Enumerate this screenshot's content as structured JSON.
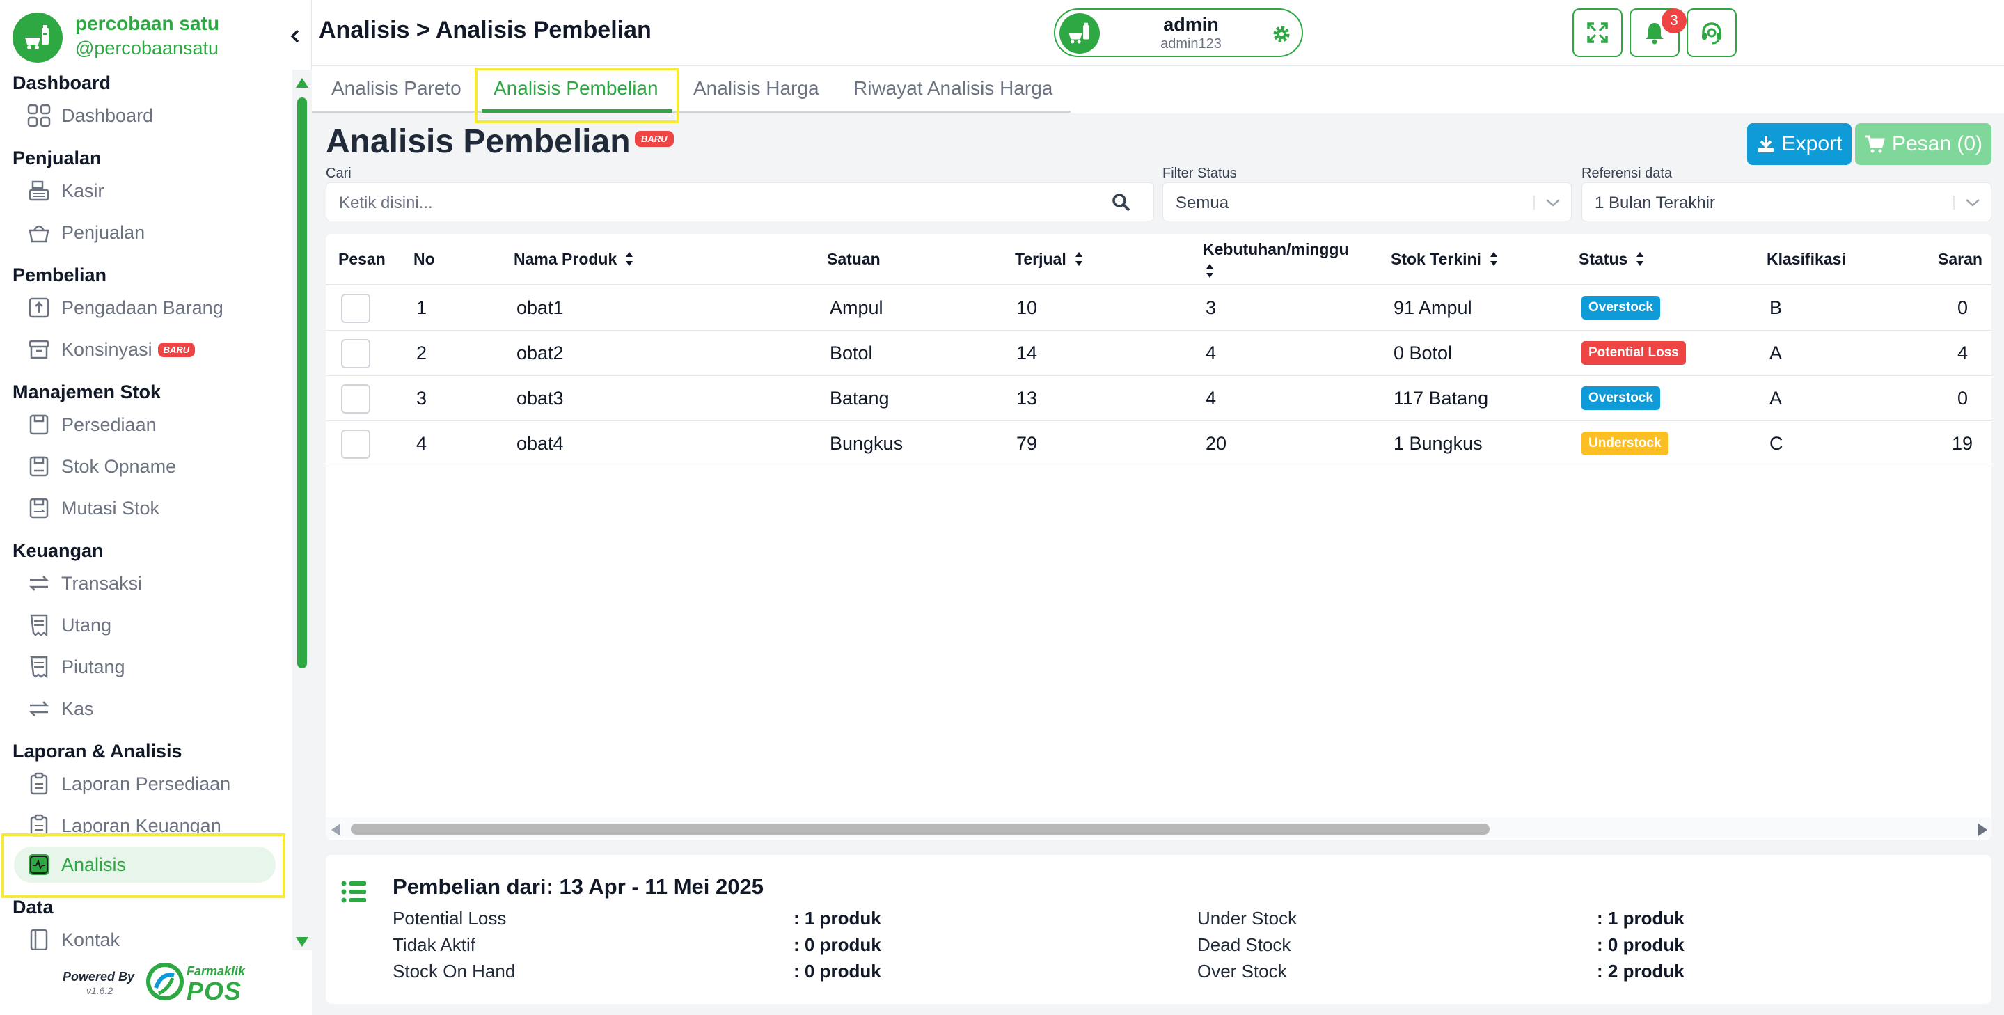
{
  "brand": {
    "store_name": "percobaan satu",
    "store_handle": "@percobaansatu"
  },
  "sidebar": {
    "sections": [
      {
        "title": "Dashboard",
        "items": [
          {
            "label": "Dashboard",
            "icon": "grid-icon"
          }
        ]
      },
      {
        "title": "Penjualan",
        "items": [
          {
            "label": "Kasir",
            "icon": "cash-register-icon"
          },
          {
            "label": "Penjualan",
            "icon": "basket-icon"
          }
        ]
      },
      {
        "title": "Pembelian",
        "items": [
          {
            "label": "Pengadaan Barang",
            "icon": "procurement-icon"
          },
          {
            "label": "Konsinyasi",
            "icon": "archive-box-icon",
            "badge": "BARU"
          }
        ]
      },
      {
        "title": "Manajemen Stok",
        "items": [
          {
            "label": "Persediaan",
            "icon": "inventory-icon"
          },
          {
            "label": "Stok Opname",
            "icon": "stock-opname-icon"
          },
          {
            "label": "Mutasi Stok",
            "icon": "stock-mutation-icon"
          }
        ]
      },
      {
        "title": "Keuangan",
        "items": [
          {
            "label": "Transaksi",
            "icon": "exchange-icon"
          },
          {
            "label": "Utang",
            "icon": "receipt-icon"
          },
          {
            "label": "Piutang",
            "icon": "receipt-icon"
          },
          {
            "label": "Kas",
            "icon": "exchange-icon"
          }
        ]
      },
      {
        "title": "Laporan & Analisis",
        "items": [
          {
            "label": "Laporan Persediaan",
            "icon": "clipboard-icon"
          },
          {
            "label": "Laporan Keuangan",
            "icon": "clipboard-icon"
          },
          {
            "label": "Analisis",
            "icon": "analytics-icon",
            "active": true
          }
        ]
      },
      {
        "title": "Data",
        "items": [
          {
            "label": "Kontak",
            "icon": "contact-book-icon"
          }
        ]
      }
    ],
    "powered_by": "Powered By",
    "version": "v1.6.2",
    "brand_small": "Farmaklik",
    "brand_big": "POS"
  },
  "topbar": {
    "breadcrumb": "Analisis > Analisis Pembelian",
    "notification_count": "3",
    "user_name": "admin",
    "user_role": "admin123"
  },
  "tabs": [
    {
      "label": "Analisis Pareto",
      "active": false
    },
    {
      "label": "Analisis Pembelian",
      "active": true
    },
    {
      "label": "Analisis Harga",
      "active": false
    },
    {
      "label": "Riwayat Analisis Harga",
      "active": false
    }
  ],
  "page": {
    "title": "Analisis Pembelian",
    "title_badge": "BARU",
    "export_label": "Export",
    "pesan_label": "Pesan (0)"
  },
  "filters": {
    "search_label": "Cari",
    "search_placeholder": "Ketik disini...",
    "status_label": "Filter Status",
    "status_value": "Semua",
    "reference_label": "Referensi data",
    "reference_value": "1 Bulan Terakhir"
  },
  "table": {
    "columns": [
      "Pesan",
      "No",
      "Nama Produk",
      "Satuan",
      "Terjual",
      "Kebutuhan/minggu",
      "Stok Terkini",
      "Status",
      "Klasifikasi",
      "Saran"
    ],
    "rows": [
      {
        "no": "1",
        "nama": "obat1",
        "satuan": "Ampul",
        "terjual": "10",
        "kebutuhan": "3",
        "stok": "91 Ampul",
        "status": "Overstock",
        "klasifikasi": "B",
        "saran": "0"
      },
      {
        "no": "2",
        "nama": "obat2",
        "satuan": "Botol",
        "terjual": "14",
        "kebutuhan": "4",
        "stok": "0 Botol",
        "status": "Potential Loss",
        "klasifikasi": "A",
        "saran": "4"
      },
      {
        "no": "3",
        "nama": "obat3",
        "satuan": "Batang",
        "terjual": "13",
        "kebutuhan": "4",
        "stok": "117 Batang",
        "status": "Overstock",
        "klasifikasi": "A",
        "saran": "0"
      },
      {
        "no": "4",
        "nama": "obat4",
        "satuan": "Bungkus",
        "terjual": "79",
        "kebutuhan": "20",
        "stok": "1 Bungkus",
        "status": "Understock",
        "klasifikasi": "C",
        "saran": "19"
      }
    ]
  },
  "summary": {
    "title": "Pembelian dari: 13 Apr - 11 Mei 2025",
    "items": [
      {
        "label": "Potential Loss",
        "value": ": 1 produk"
      },
      {
        "label": "Tidak Aktif",
        "value": ": 0 produk"
      },
      {
        "label": "Stock On Hand",
        "value": ": 0 produk"
      },
      {
        "label": "Under Stock",
        "value": ": 1 produk"
      },
      {
        "label": "Dead Stock",
        "value": ": 0 produk"
      },
      {
        "label": "Over Stock",
        "value": ": 2 produk"
      }
    ]
  },
  "colors": {
    "brand_green": "#2ea843",
    "export_blue": "#0f9bd7",
    "pesan_disabled": "#7fd89a",
    "status_overstock": "#0f9bd7",
    "status_potential_loss": "#ef4444",
    "status_understock": "#fbbf24",
    "highlight_yellow": "#f7ea34"
  }
}
